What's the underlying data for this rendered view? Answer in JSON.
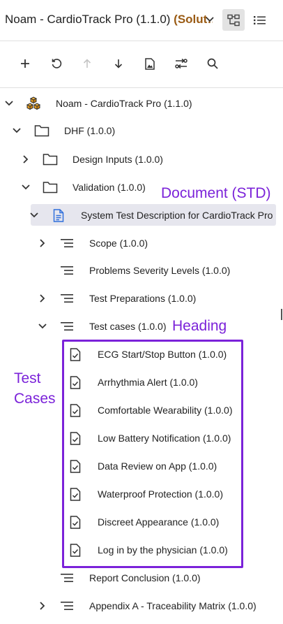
{
  "header": {
    "title_main": "Noam - CardioTrack Pro (1.1.0) ",
    "title_accent": "(Solut…",
    "icons": {
      "dropdown": "chevron-down-icon",
      "tree_view": "tree-view-icon",
      "list_view": "list-view-icon"
    }
  },
  "toolbar": {
    "buttons": [
      "add-icon",
      "refresh-icon",
      "move-up-icon",
      "move-down-icon",
      "image-doc-icon",
      "compare-icon",
      "search-icon"
    ]
  },
  "tree": {
    "rows": [
      {
        "label": "Noam - CardioTrack Pro (1.1.0)",
        "icon": "product-cubes-icon",
        "expand": "expanded"
      },
      {
        "label": "DHF (1.0.0)",
        "icon": "folder-icon",
        "expand": "expanded"
      },
      {
        "label": "Design Inputs (1.0.0)",
        "icon": "folder-icon",
        "expand": "collapsed"
      },
      {
        "label": "Validation (1.0.0)",
        "icon": "folder-icon",
        "expand": "expanded"
      },
      {
        "label": "System Test Description for CardioTrack Pro",
        "icon": "document-icon",
        "expand": "expanded"
      },
      {
        "label": "Scope (1.0.0)",
        "icon": "heading-icon",
        "expand": "collapsed"
      },
      {
        "label": "Problems Severity Levels (1.0.0)",
        "icon": "heading-icon",
        "expand": "none"
      },
      {
        "label": "Test Preparations (1.0.0)",
        "icon": "heading-icon",
        "expand": "collapsed"
      },
      {
        "label": "Test cases (1.0.0)",
        "icon": "heading-icon",
        "expand": "expanded"
      },
      {
        "label": "ECG Start/Stop Button (1.0.0)",
        "icon": "test-case-icon",
        "expand": "none"
      },
      {
        "label": "Arrhythmia Alert (1.0.0)",
        "icon": "test-case-icon",
        "expand": "none"
      },
      {
        "label": "Comfortable Wearability (1.0.0)",
        "icon": "test-case-icon",
        "expand": "none"
      },
      {
        "label": "Low Battery Notification (1.0.0)",
        "icon": "test-case-icon",
        "expand": "none"
      },
      {
        "label": "Data Review on App (1.0.0)",
        "icon": "test-case-icon",
        "expand": "none"
      },
      {
        "label": "Waterproof Protection (1.0.0)",
        "icon": "test-case-icon",
        "expand": "none"
      },
      {
        "label": "Discreet Appearance (1.0.0)",
        "icon": "test-case-icon",
        "expand": "none"
      },
      {
        "label": "Log in by the physician (1.0.0)",
        "icon": "test-case-icon",
        "expand": "none"
      },
      {
        "label": "Report Conclusion (1.0.0)",
        "icon": "heading-icon",
        "expand": "none"
      },
      {
        "label": "Appendix A - Traceability Matrix (1.0.0)",
        "icon": "heading-icon",
        "expand": "collapsed"
      }
    ]
  },
  "annotations": {
    "document": "Document (STD)",
    "heading": "Heading",
    "test_cases_line1": "Test",
    "test_cases_line2": "Cases"
  },
  "colors": {
    "accent_title": "#9a5b14",
    "annotation": "#7b22d9",
    "selection": "#e6e6ee",
    "document_icon": "#2f6fdb"
  }
}
